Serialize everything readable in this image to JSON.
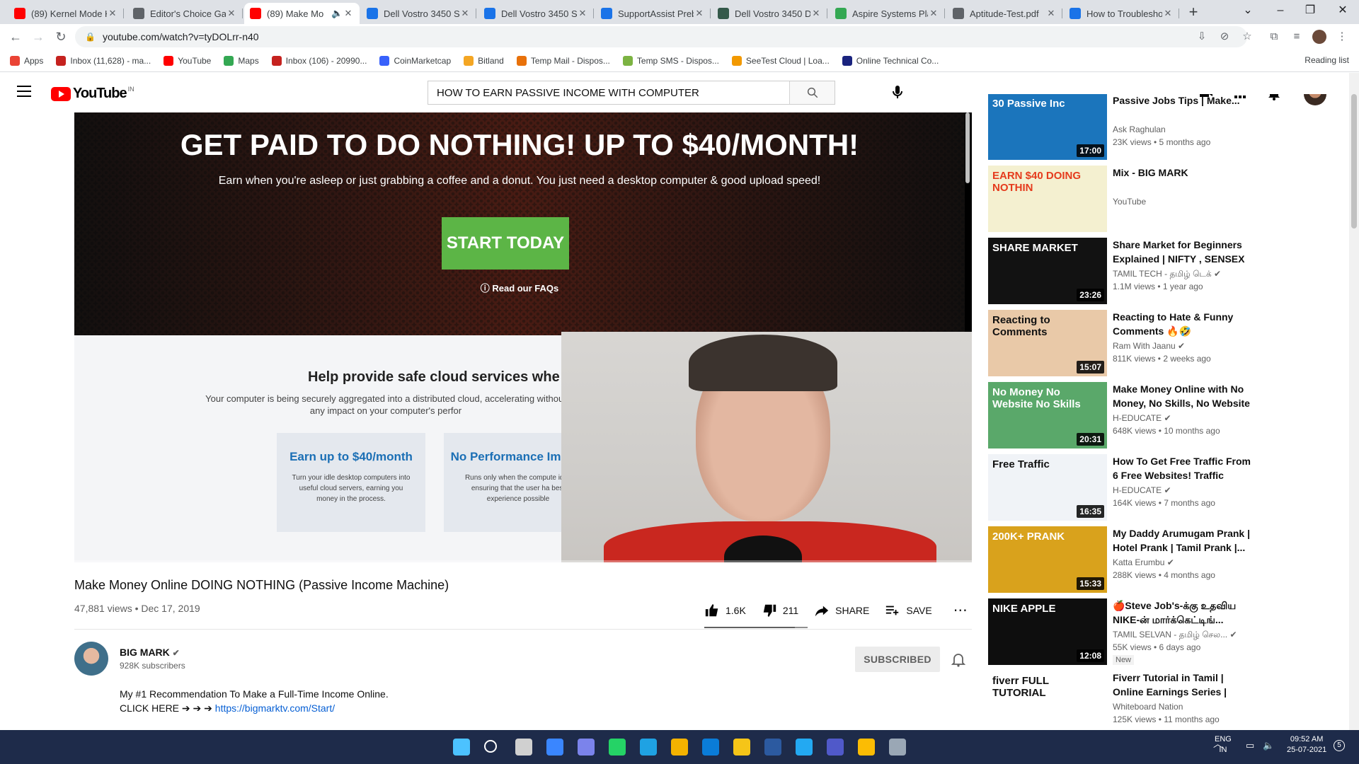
{
  "browser": {
    "tabs": [
      {
        "title": "(89) Kernel Mode H",
        "color": "#ff0000"
      },
      {
        "title": "Editor's Choice Gar",
        "color": "#5f6368"
      },
      {
        "title": "(89) Make Mo",
        "color": "#ff0000",
        "active": true
      },
      {
        "title": "Dell Vostro 3450 Sy",
        "color": "#1a73e8"
      },
      {
        "title": "Dell Vostro 3450 Sy",
        "color": "#1a73e8"
      },
      {
        "title": "SupportAssist Preb",
        "color": "#1a73e8"
      },
      {
        "title": "Dell Vostro 3450 D",
        "color": "#34594a"
      },
      {
        "title": "Aspire Systems Pla",
        "color": "#34a853"
      },
      {
        "title": "Aptitude-Test.pdf",
        "color": "#5f6368"
      },
      {
        "title": "How to Troublesho",
        "color": "#1a73e8"
      }
    ],
    "url": "youtube.com/watch?v=tyDOLrr-n40",
    "bookmarks": [
      {
        "label": "Apps",
        "color": "#ea4335"
      },
      {
        "label": "Inbox (11,628) - ma...",
        "color": "#c5221f"
      },
      {
        "label": "YouTube",
        "color": "#ff0000"
      },
      {
        "label": "Maps",
        "color": "#34a853"
      },
      {
        "label": "Inbox (106) - 20990...",
        "color": "#c5221f"
      },
      {
        "label": "CoinMarketcap",
        "color": "#3861fb"
      },
      {
        "label": "Bitland",
        "color": "#f4a623"
      },
      {
        "label": "Temp Mail - Dispos...",
        "color": "#e8710a"
      },
      {
        "label": "Temp SMS - Dispos...",
        "color": "#7cb342"
      },
      {
        "label": "SeeTest Cloud | Loa...",
        "color": "#f29900"
      },
      {
        "label": "Online Technical Co...",
        "color": "#1a237e"
      }
    ],
    "reading_list": "Reading list"
  },
  "yt": {
    "logo": "YouTube",
    "country": "IN",
    "search_value": "HOW TO EARN PASSIVE INCOME WITH COMPUTER",
    "notif_count": "9+"
  },
  "player": {
    "headline": "GET PAID TO DO NOTHING! UP TO $40/MONTH!",
    "subhead": "Earn when you're asleep or just grabbing a coffee and a donut. You just need a desktop computer & good upload speed!",
    "cta": "START TODAY",
    "faq": "Read our FAQs",
    "section_title": "Help provide safe cloud services whe",
    "section_text": "Your computer is being securely aggregated into a distributed cloud, accelerating without any impact on your computer's perfor",
    "card1_title": "Earn up to $40/month",
    "card1_text": "Turn your idle desktop computers into useful cloud servers, earning you money in the process.",
    "card2_title": "No Performance Impact",
    "card2_text": "Runs only when the compute idle, ensuring that the user ha best experience possible"
  },
  "video": {
    "title": "Make Money Online DOING NOTHING (Passive Income Machine)",
    "meta": "47,881 views • Dec 17, 2019",
    "likes": "1.6K",
    "dislikes": "211",
    "share": "SHARE",
    "save": "SAVE",
    "channel": "BIG MARK",
    "subscribers": "928K subscribers",
    "subscribed": "SUBSCRIBED",
    "desc1": "My #1 Recommendation To Make a Full-Time Income Online.",
    "desc2": "CLICK HERE ➔ ➔ ➔",
    "desc_link": "https://bigmarktv.com/Start/"
  },
  "sidebar": [
    {
      "title": "Passive Jobs Tips | Make...",
      "channel": "Ask Raghulan",
      "meta": "23K views • 5 months ago",
      "duration": "17:00",
      "thumb": "#1b75bc",
      "thumb_text": "30 Passive Inc"
    },
    {
      "title": "Mix - BIG MARK",
      "channel": "YouTube",
      "meta": "",
      "duration": "",
      "thumb": "#f4f0d0",
      "thumb_text": "EARN $40 DOING NOTHIN"
    },
    {
      "title": "Share Market for Beginners Explained | NIFTY , SENSEX ?...",
      "channel": "TAMIL TECH - தமிழ் டெக் ✔",
      "meta": "1.1M views • 1 year ago",
      "duration": "23:26",
      "thumb": "#121212",
      "thumb_text": "SHARE MARKET"
    },
    {
      "title": "Reacting to Hate & Funny Comments 🔥🤣",
      "channel": "Ram With Jaanu ✔",
      "meta": "811K views • 2 weeks ago",
      "duration": "15:07",
      "thumb": "#e9c9a8",
      "thumb_text": "Reacting to Comments"
    },
    {
      "title": "Make Money Online with No Money, No Skills, No Website ...",
      "channel": "H-EDUCATE ✔",
      "meta": "648K views • 10 months ago",
      "duration": "20:31",
      "thumb": "#5aa86a",
      "thumb_text": "No Money No Website No Skills"
    },
    {
      "title": "How To Get Free Traffic From 6 Free Websites! Traffic Bombe...",
      "channel": "H-EDUCATE ✔",
      "meta": "164K views • 7 months ago",
      "duration": "16:35",
      "thumb": "#f0f3f7",
      "thumb_text": "Free Traffic"
    },
    {
      "title": "My Daddy Arumugam Prank | Hotel Prank | Tamil Prank |...",
      "channel": "Katta Erumbu ✔",
      "meta": "288K views • 4 months ago",
      "duration": "15:33",
      "thumb": "#d9a21c",
      "thumb_text": "200K+ PRANK"
    },
    {
      "title": "🍎Steve Job's-க்கு உதவிய NIKE-ன் மார்க்கெட்டிங்...",
      "channel": "TAMIL SELVAN - தமிழ் செல... ✔",
      "meta": "55K views • 6 days ago",
      "duration": "12:08",
      "thumb": "#0e0e0e",
      "thumb_text": "NIKE APPLE",
      "badge": "New"
    },
    {
      "title": "Fiverr Tutorial in Tamil | Online Earnings Series | Whiteboard...",
      "channel": "Whiteboard Nation",
      "meta": "125K views • 11 months ago",
      "duration": "",
      "thumb": "#ffffff",
      "thumb_text": "fiverr FULL TUTORIAL"
    }
  ],
  "taskbar": {
    "lang1": "ENG",
    "lang2": "IN",
    "time": "09:52 AM",
    "date": "25-07-2021",
    "notif": "5"
  }
}
